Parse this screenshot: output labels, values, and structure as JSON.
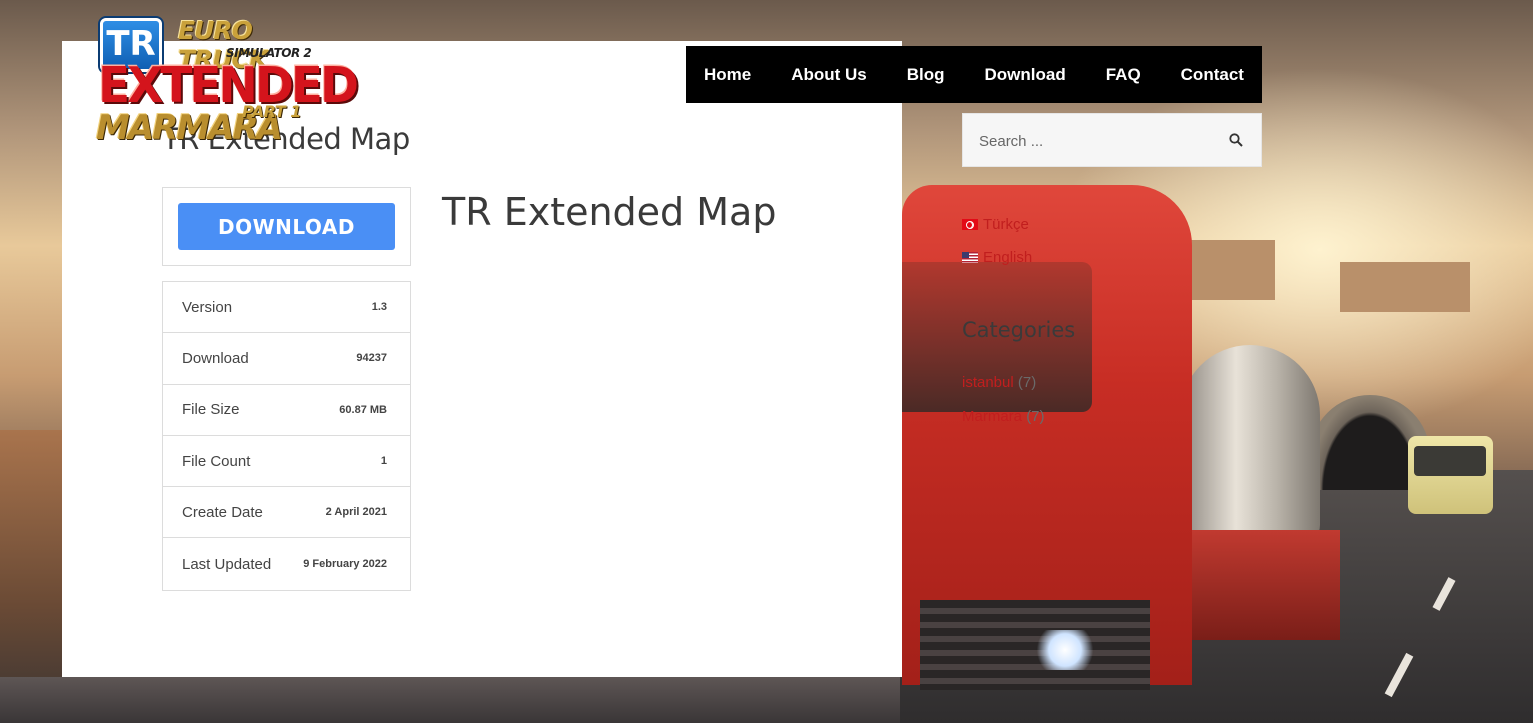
{
  "logo": {
    "badge": "TR",
    "line1": "EURO TRUCK",
    "line2": "SIMULATOR 2",
    "line3": "EXTENDED",
    "line4": "MARMARA",
    "line5": "PART 1"
  },
  "nav": {
    "items": [
      "Home",
      "About Us",
      "Blog",
      "Download",
      "FAQ",
      "Contact"
    ]
  },
  "search": {
    "placeholder": "Search ..."
  },
  "languages": [
    {
      "label": "Türkçe",
      "flag": "tr-flag-icon"
    },
    {
      "label": "English",
      "flag": "us-flag-icon"
    }
  ],
  "categories": {
    "title": "Categories",
    "items": [
      {
        "label": "istanbul",
        "count": "(7)"
      },
      {
        "label": "Marmara",
        "count": "(7)"
      }
    ]
  },
  "page": {
    "title": "TR Extended Map",
    "content_title": "TR Extended Map"
  },
  "download": {
    "button_label": "DOWNLOAD",
    "button_color": "#4a8ff5"
  },
  "info": [
    {
      "label": "Version",
      "value": "1.3"
    },
    {
      "label": "Download",
      "value": "94237"
    },
    {
      "label": "File Size",
      "value": "60.87 MB"
    },
    {
      "label": "File Count",
      "value": "1"
    },
    {
      "label": "Create Date",
      "value": "2 April 2021"
    },
    {
      "label": "Last Updated",
      "value": "9 February 2022"
    }
  ],
  "colors": {
    "nav_bg": "#000000",
    "link": "#c11e1e"
  }
}
